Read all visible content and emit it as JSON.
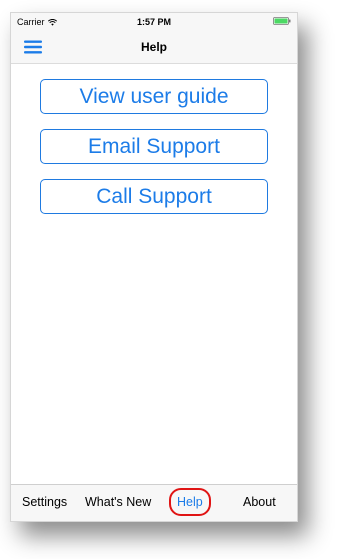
{
  "status_bar": {
    "carrier": "Carrier",
    "time": "1:57 PM",
    "wifi_icon": "wifi-icon",
    "battery_icon": "battery-icon",
    "battery_color": "#4cd964"
  },
  "nav_bar": {
    "title": "Help",
    "menu_icon": "hamburger-menu-icon",
    "accent": "#1c7ce8"
  },
  "main": {
    "buttons": [
      {
        "label": "View user guide"
      },
      {
        "label": "Email Support"
      },
      {
        "label": "Call Support"
      }
    ]
  },
  "tab_bar": {
    "tabs": [
      {
        "label": "Settings",
        "selected": false
      },
      {
        "label": "What's New",
        "selected": false
      },
      {
        "label": "Help",
        "selected": true
      },
      {
        "label": "About",
        "selected": false
      }
    ],
    "selected_color": "#1c7ce8",
    "highlight_color": "#e01414"
  }
}
